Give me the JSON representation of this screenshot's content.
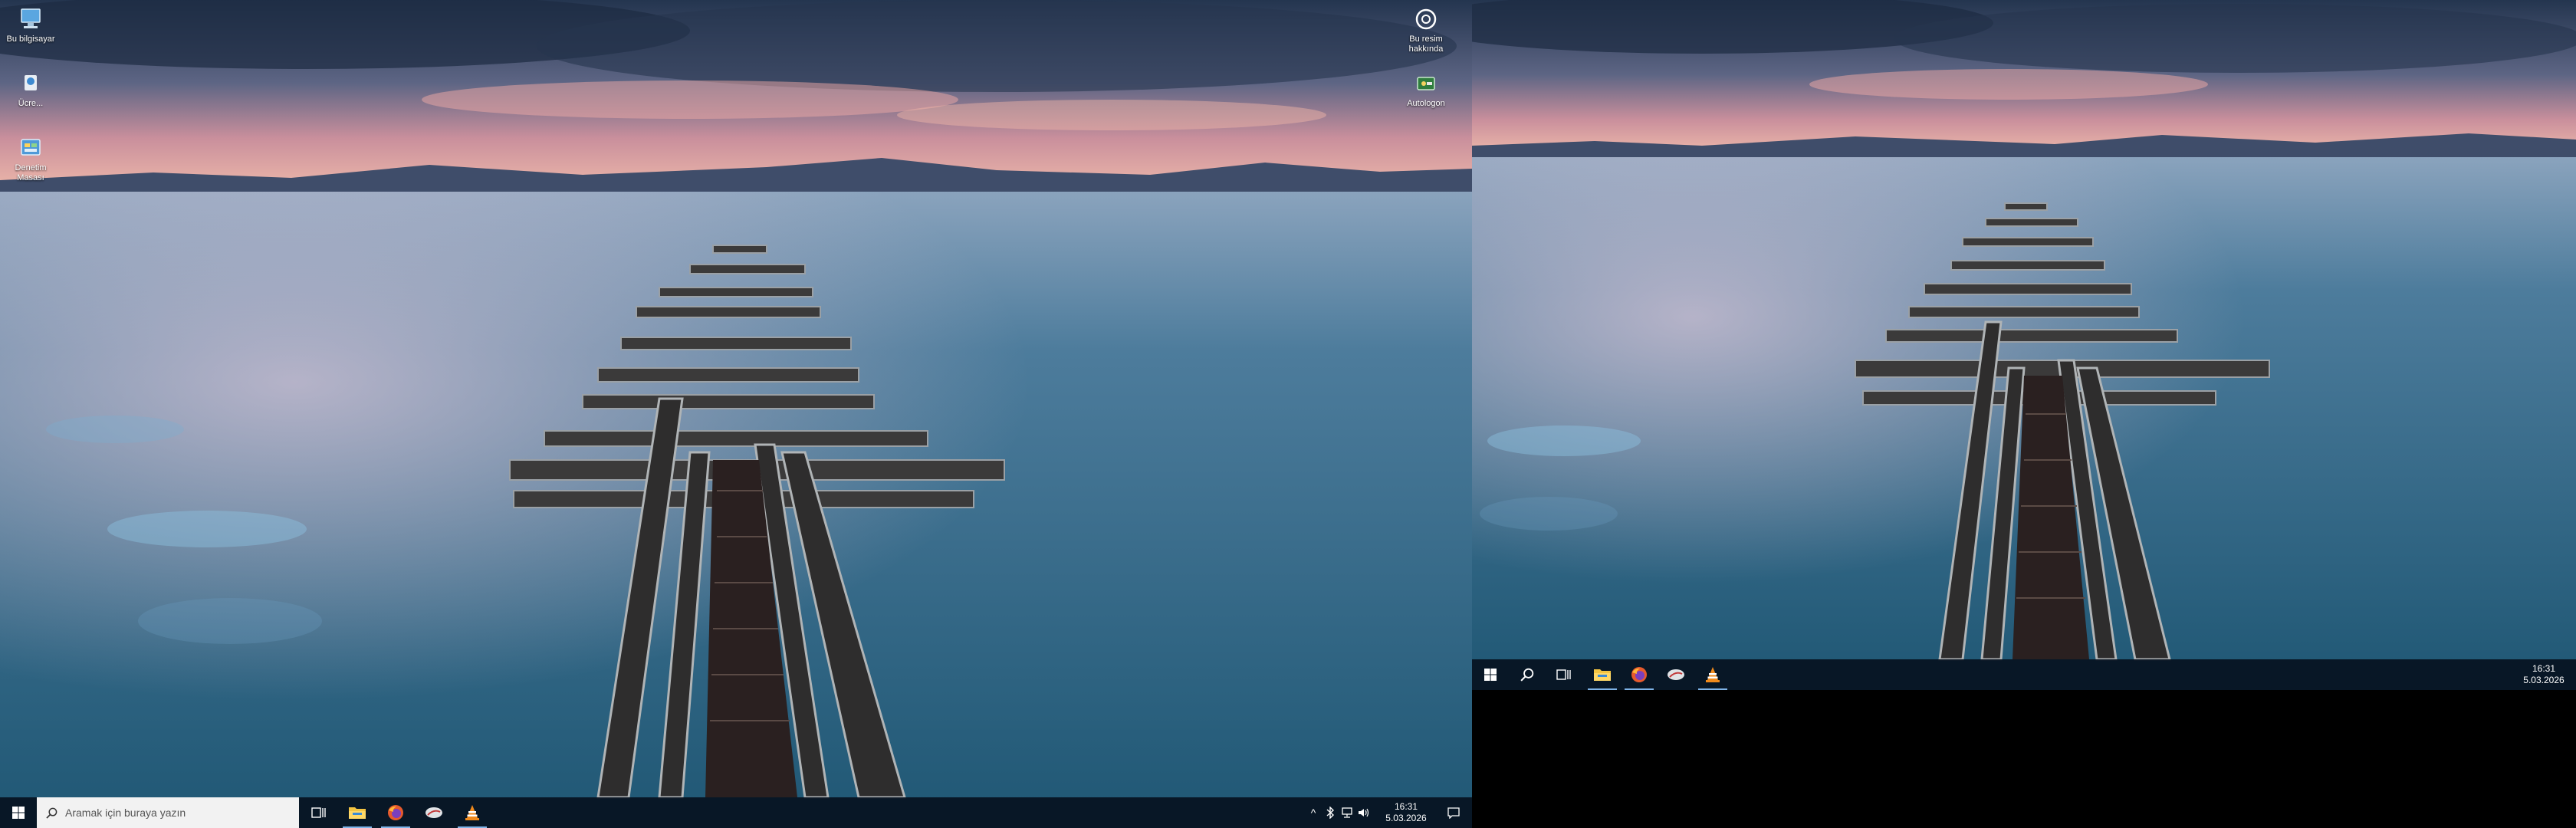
{
  "desktop_icons": {
    "this_pc": {
      "label": "Bu bilgisayar"
    },
    "control_panel": {
      "label": "Denetim Masası"
    },
    "about_picture": {
      "label": "Bu resim hakkında"
    },
    "partial_icon": {
      "label": "Ücre..."
    },
    "autologon": {
      "label": "Autologon"
    }
  },
  "left_taskbar": {
    "start": {
      "icon": "windows-logo-icon"
    },
    "search": {
      "placeholder": "Aramak için buraya yazın",
      "icon": "search-icon"
    },
    "task_view": {
      "icon": "task-view-icon"
    },
    "pinned": [
      {
        "name": "File Explorer",
        "icon": "folder-icon",
        "active": true
      },
      {
        "name": "Firefox",
        "icon": "firefox-icon",
        "active": true
      },
      {
        "name": "App",
        "icon": "eraser-icon",
        "active": false
      },
      {
        "name": "VLC",
        "icon": "vlc-icon",
        "active": true
      }
    ],
    "tray": {
      "chevron": "^",
      "icons": [
        "bluetooth-icon",
        "network-icon",
        "volume-icon"
      ]
    },
    "clock": {
      "time": "16:31",
      "date": "5.03.2026"
    },
    "notifications": {
      "icon": "notification-icon"
    }
  },
  "right_taskbar": {
    "start": {
      "icon": "windows-logo-icon"
    },
    "search": {
      "icon": "search-icon"
    },
    "task_view": {
      "icon": "task-view-icon"
    },
    "pinned": [
      {
        "name": "File Explorer",
        "icon": "folder-icon",
        "active": true
      },
      {
        "name": "Firefox",
        "icon": "firefox-icon",
        "active": true
      },
      {
        "name": "App",
        "icon": "eraser-icon",
        "active": false
      },
      {
        "name": "VLC",
        "icon": "vlc-icon",
        "active": true
      }
    ],
    "clock": {
      "time": "16:31",
      "date": "5.03.2026"
    }
  },
  "colors": {
    "taskbar": "#061220",
    "sky_top": "#2d3f5a",
    "sunset": "#e8a0a0",
    "water": "#2b6584",
    "accent": "#7fb4e8"
  }
}
